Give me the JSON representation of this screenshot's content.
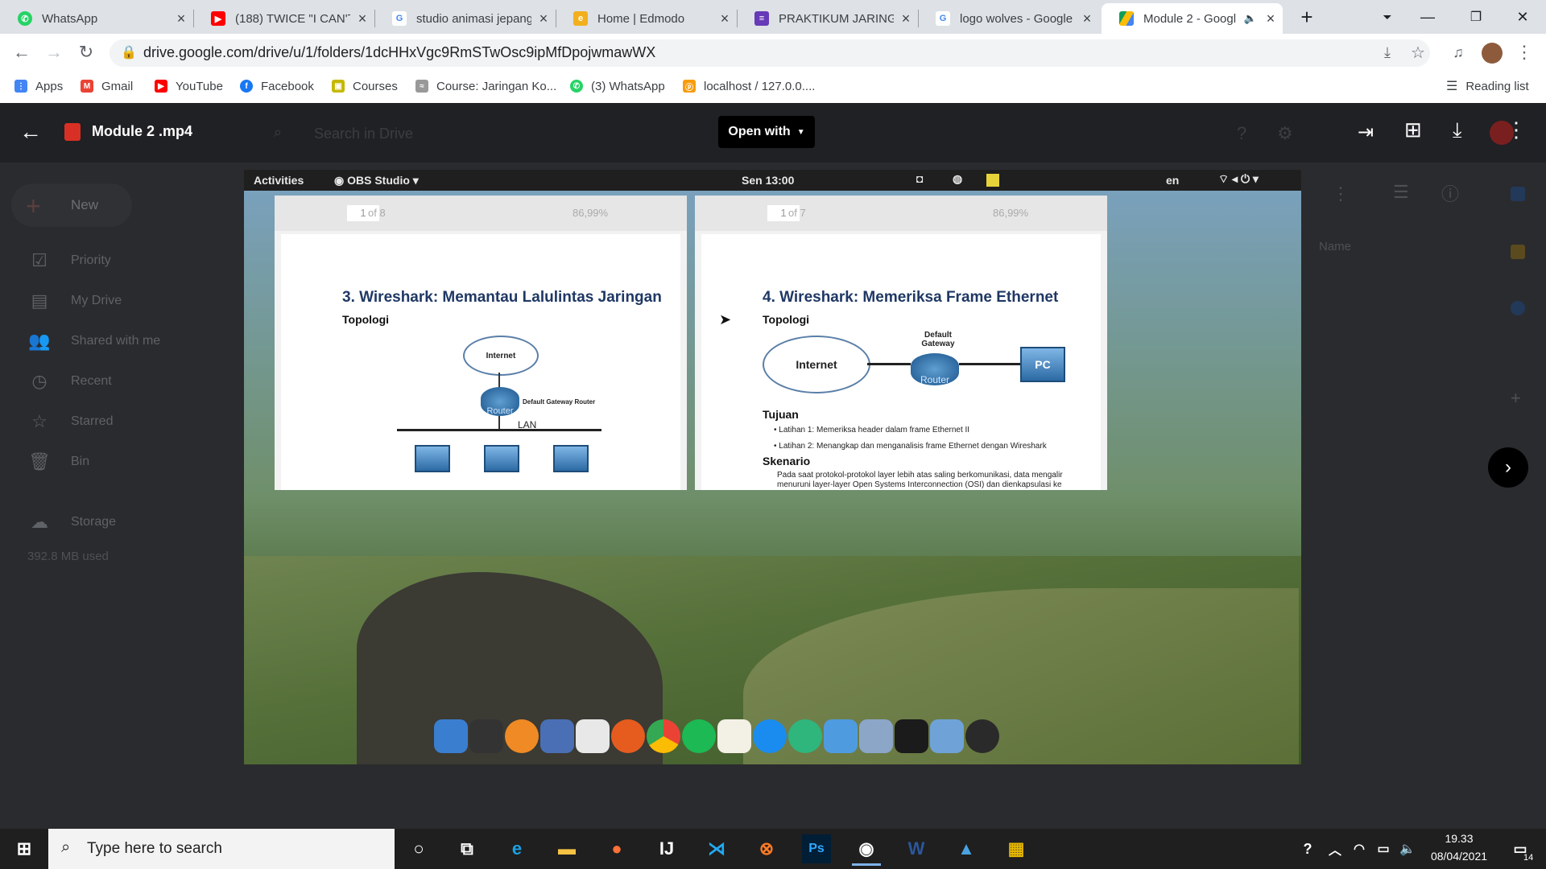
{
  "browser": {
    "tabs": [
      {
        "title": "WhatsApp",
        "icon": "whatsapp-icon",
        "color": "#25d366"
      },
      {
        "title": "(188) TWICE \"I CAN'T",
        "icon": "youtube-icon",
        "color": "#ff0000"
      },
      {
        "title": "studio animasi jepang",
        "icon": "google-icon",
        "color": "#4285f4"
      },
      {
        "title": "Home | Edmodo",
        "icon": "edmodo-icon",
        "color": "#f2b01e"
      },
      {
        "title": "PRAKTIKUM JARINGA",
        "icon": "forms-icon",
        "color": "#673ab7"
      },
      {
        "title": "logo wolves - Google",
        "icon": "google-icon",
        "color": "#4285f4"
      },
      {
        "title": "Module 2 - Googl",
        "icon": "drive-icon",
        "color": "#fbbc04",
        "active": true
      }
    ],
    "url": "drive.google.com/drive/u/1/folders/1dcHHxVgc9RmSTwOsc9ipMfDpojwmawWX",
    "bookmarks": [
      {
        "label": "Apps",
        "icon": "apps-grid-icon",
        "color": "#4285f4"
      },
      {
        "label": "Gmail",
        "icon": "gmail-icon",
        "color": "#ea4335"
      },
      {
        "label": "YouTube",
        "icon": "youtube-icon",
        "color": "#ff0000"
      },
      {
        "label": "Facebook",
        "icon": "facebook-icon",
        "color": "#1877f2"
      },
      {
        "label": "Courses",
        "icon": "courses-icon",
        "color": "#c5b800"
      },
      {
        "label": "Course: Jaringan Ko...",
        "icon": "cisco-icon",
        "color": "#999999"
      },
      {
        "label": "(3) WhatsApp",
        "icon": "whatsapp-icon",
        "color": "#25d366"
      },
      {
        "label": "localhost / 127.0.0....",
        "icon": "phpmyadmin-icon",
        "color": "#f89c0e"
      }
    ],
    "reading_list": "Reading list"
  },
  "viewer": {
    "file_name": "Module 2 .mp4",
    "open_with": "Open with",
    "drive_sidebar": {
      "new_label": "New",
      "items": [
        "Priority",
        "My Drive",
        "Shared with me",
        "Recent",
        "Starred",
        "Bin",
        "Storage"
      ],
      "storage_used": "392.8 MB used"
    },
    "search_placeholder": "Search in Drive",
    "list_header": "Name"
  },
  "video": {
    "gnome": {
      "activities": "Activities",
      "app": "OBS Studio",
      "clock": "Sen 13:00",
      "lang": "en"
    },
    "doc_left": {
      "page": "1",
      "of": "of 8",
      "zoom": "86,99%",
      "title": "3. Wireshark: Memantau Lalulintas Jaringan",
      "topologi": "Topologi",
      "internet": "Internet",
      "router": "Router",
      "gateway": "Default Gateway Router",
      "lan": "LAN"
    },
    "doc_right": {
      "page": "1",
      "of": "of 7",
      "zoom": "86,99%",
      "title": "4. Wireshark: Memeriksa Frame Ethernet",
      "topologi": "Topologi",
      "internet": "Internet",
      "router": "Router",
      "gateway": "Default Gateway",
      "pc": "PC",
      "tujuan": "Tujuan",
      "bullets": [
        "Latihan 1: Memeriksa header dalam frame Ethernet II",
        "Latihan 2: Menangkap dan menganalisis frame Ethernet dengan Wireshark"
      ],
      "skenario": "Skenario",
      "skenario_text": "Pada saat protokol-protokol layer lebih atas saling berkomunikasi, data mengalir menuruni layer-layer Open Systems Interconnection (OSI) dan dienkapsulasi ke"
    }
  },
  "taskbar": {
    "search_placeholder": "Type here to search",
    "time": "19.33",
    "date": "08/04/2021",
    "notifications": "14"
  }
}
